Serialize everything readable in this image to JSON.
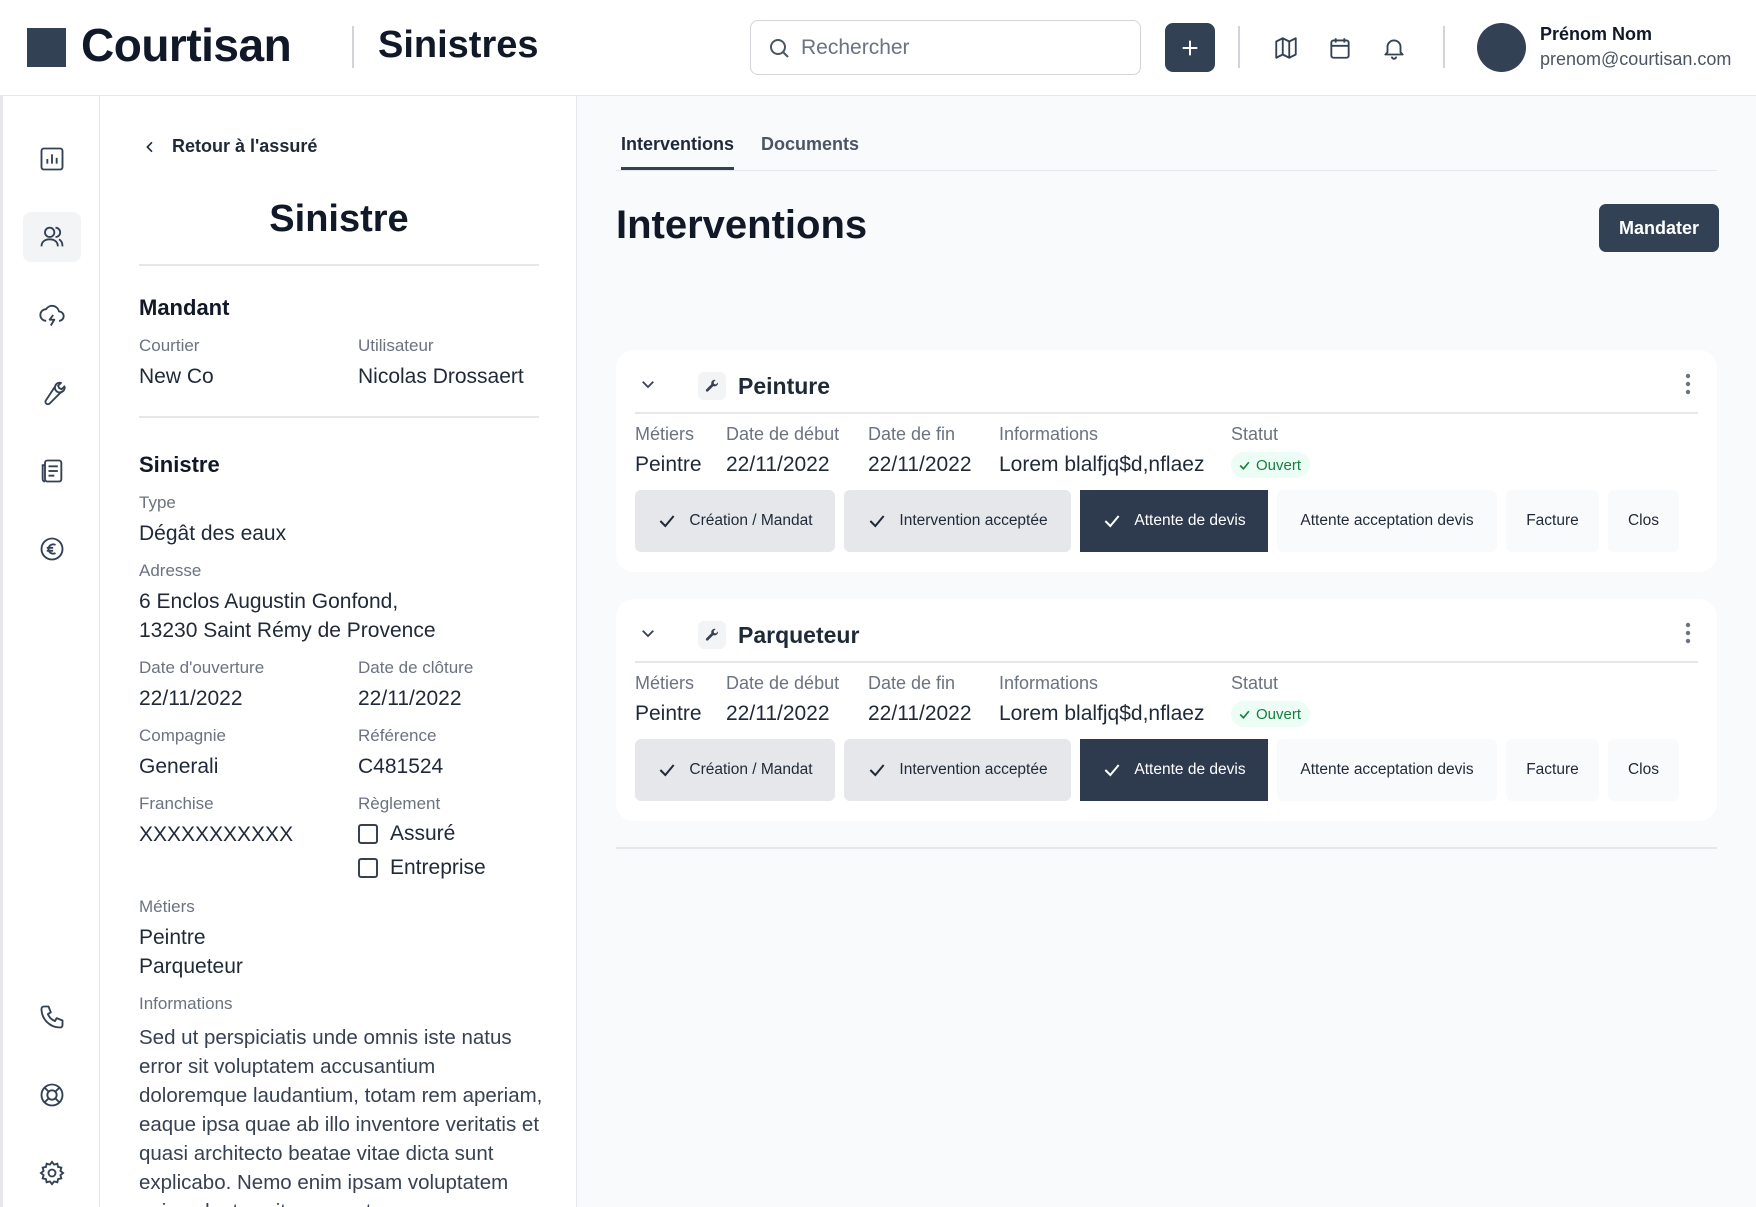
{
  "header": {
    "brand": "Courtisan",
    "section": "Sinistres",
    "search_placeholder": "Rechercher",
    "user_name": "Prénom Nom",
    "user_email": "prenom@courtisan.com"
  },
  "detail": {
    "back_label": "Retour à l'assuré",
    "title": "Sinistre",
    "mandant": {
      "title": "Mandant",
      "courtier_label": "Courtier",
      "courtier_value": "New Co",
      "utilisateur_label": "Utilisateur",
      "utilisateur_value": "Nicolas Drossaert"
    },
    "sinistre": {
      "title": "Sinistre",
      "type_label": "Type",
      "type_value": "Dégât des eaux",
      "adresse_label": "Adresse",
      "adresse_line1": "6 Enclos Augustin Gonfond,",
      "adresse_line2": "13230 Saint Rémy de Provence",
      "ouverture_label": "Date d'ouverture",
      "ouverture_value": "22/11/2022",
      "cloture_label": "Date de clôture",
      "cloture_value": "22/11/2022",
      "compagnie_label": "Compagnie",
      "compagnie_value": "Generali",
      "reference_label": "Référence",
      "reference_value": "C481524",
      "franchise_label": "Franchise",
      "franchise_value": "XXXXXXXXXXX",
      "reglement_label": "Règlement",
      "reglement_opt1": "Assuré",
      "reglement_opt2": "Entreprise",
      "metiers_label": "Métiers",
      "metiers": [
        "Peintre",
        "Parqueteur"
      ],
      "informations_label": "Informations",
      "informations_text": "Sed ut perspiciatis unde omnis iste natus error sit voluptatem accusantium doloremque laudantium, totam rem aperiam, eaque ipsa quae ab illo inventore veritatis et quasi architecto beatae vitae dicta sunt explicabo. Nemo enim ipsam voluptatem quia voluptas sit aspernatur"
    }
  },
  "main": {
    "tabs": [
      "Interventions",
      "Documents"
    ],
    "title": "Interventions",
    "mandater_label": "Mandater",
    "field_labels": {
      "metiers": "Métiers",
      "debut": "Date de début",
      "fin": "Date de fin",
      "informations": "Informations",
      "statut": "Statut"
    },
    "steps": [
      "Création / Mandat",
      "Intervention acceptée",
      "Attente de devis",
      "Attente acceptation devis",
      "Facture",
      "Clos"
    ],
    "interventions": [
      {
        "title": "Peinture",
        "metier": "Peintre",
        "debut": "22/11/2022",
        "fin": "22/11/2022",
        "informations": "Lorem blalfjq$d,nflaez",
        "statut": "Ouvert"
      },
      {
        "title": "Parqueteur",
        "metier": "Peintre",
        "debut": "22/11/2022",
        "fin": "22/11/2022",
        "informations": "Lorem blalfjq$d,nflaez",
        "statut": "Ouvert"
      }
    ]
  },
  "colors": {
    "primary": "#334155",
    "status_ok": "#15803d"
  }
}
